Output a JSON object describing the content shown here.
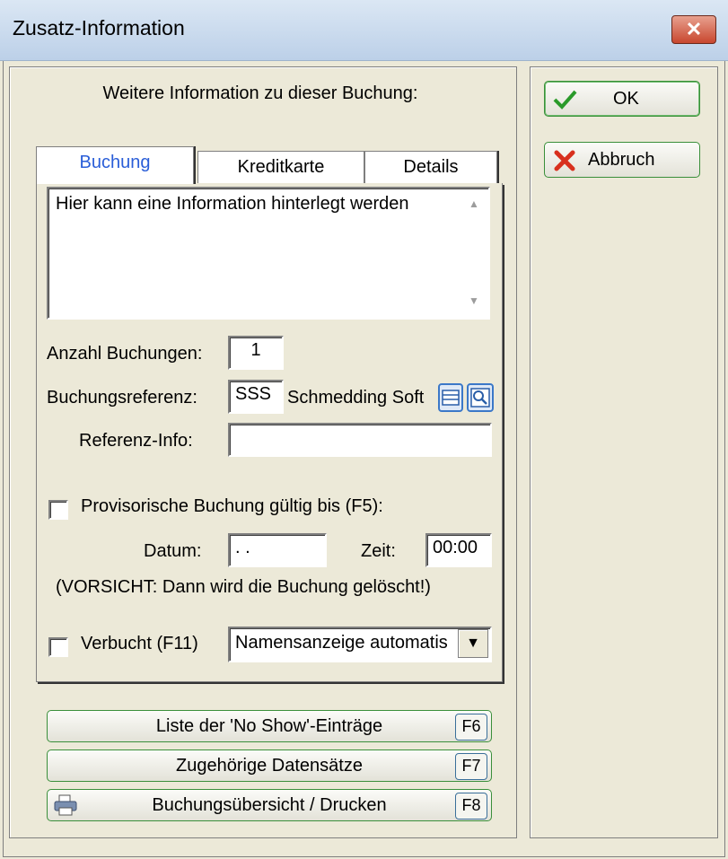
{
  "window": {
    "title": "Zusatz-Information",
    "close_label": "✕"
  },
  "header": {
    "text": "Weitere Information zu dieser Buchung:"
  },
  "tabs": [
    {
      "label": "Buchung",
      "active": true
    },
    {
      "label": "Kreditkarte"
    },
    {
      "label": "Details"
    }
  ],
  "info": {
    "text": "Hier kann eine Information hinterlegt werden"
  },
  "form": {
    "anzahl_label": "Anzahl Buchungen:",
    "anzahl_value": "1",
    "buchungsreferenz_label": "Buchungsreferenz:",
    "buchungsreferenz_value": "SSS",
    "buchungsreferenz_name": "Schmedding Soft",
    "referenzinfo_label": "Referenz-Info:",
    "referenzinfo_value": "",
    "provisorisch_label": "Provisorische Buchung gültig bis (F5):",
    "datum_label": "Datum:",
    "datum_value": " . .",
    "zeit_label": "Zeit:",
    "zeit_value": "00:00",
    "warning": "(VORSICHT: Dann wird die Buchung gelöscht!)",
    "verbucht_label": "Verbucht (F11)",
    "name_select_value": "Namensanzeige automatis"
  },
  "bottom_buttons": [
    {
      "label": "Liste der 'No Show'-Einträge",
      "key": "F6"
    },
    {
      "label": "Zugehörige Datensätze",
      "key": "F7"
    },
    {
      "label": "Buchungsübersicht / Drucken",
      "key": "F8"
    }
  ],
  "right_buttons": {
    "ok": "OK",
    "abbruch": "Abbruch"
  },
  "colors": {
    "accent_tab": "#2a5ed8",
    "button_border": "#3a8f3a",
    "close": "#c8462e"
  }
}
